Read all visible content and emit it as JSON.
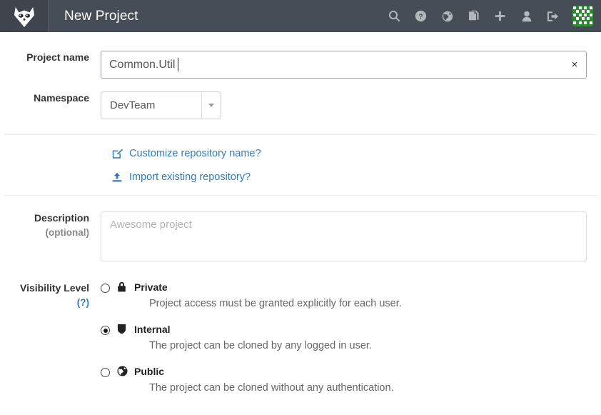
{
  "header": {
    "logo_icon": "gitlab-tanuki-icon",
    "title": "New Project",
    "icons": [
      {
        "name": "search-icon",
        "label": "Search"
      },
      {
        "name": "help-icon",
        "label": "Help"
      },
      {
        "name": "globe-icon",
        "label": "Public"
      },
      {
        "name": "snippets-icon",
        "label": "Snippets"
      },
      {
        "name": "plus-icon",
        "label": "New"
      },
      {
        "name": "user-icon",
        "label": "Profile"
      },
      {
        "name": "sign-out-icon",
        "label": "Sign out"
      }
    ],
    "avatar_icon": "user-avatar-identicon",
    "avatar_color": "#2d8a33",
    "background_color": "#474d57"
  },
  "form": {
    "project_name": {
      "label": "Project name",
      "value": "Common.Util",
      "clear_label": "×",
      "focus_color": "#66afe9"
    },
    "namespace": {
      "label": "Namespace",
      "selected": "DevTeam"
    },
    "links": [
      {
        "icon": "edit-square-icon",
        "label": "Customize repository name?"
      },
      {
        "icon": "upload-icon",
        "label": "Import existing repository?"
      }
    ],
    "description": {
      "label": "Description",
      "sub_label": "(optional)",
      "placeholder": "Awesome project",
      "value": ""
    },
    "visibility": {
      "label": "Visibility Level",
      "help_link": "(?)",
      "options": [
        {
          "icon": "lock-icon",
          "title": "Private",
          "description": "Project access must be granted explicitly for each user.",
          "selected": false
        },
        {
          "icon": "shield-icon",
          "title": "Internal",
          "description": "The project can be cloned by any logged in user.",
          "selected": true
        },
        {
          "icon": "globe-icon",
          "title": "Public",
          "description": "The project can be cloned without any authentication.",
          "selected": false
        }
      ]
    }
  },
  "colors": {
    "link": "#337ab7",
    "header_bg": "#474d57",
    "brand_bg": "#3f444d"
  }
}
